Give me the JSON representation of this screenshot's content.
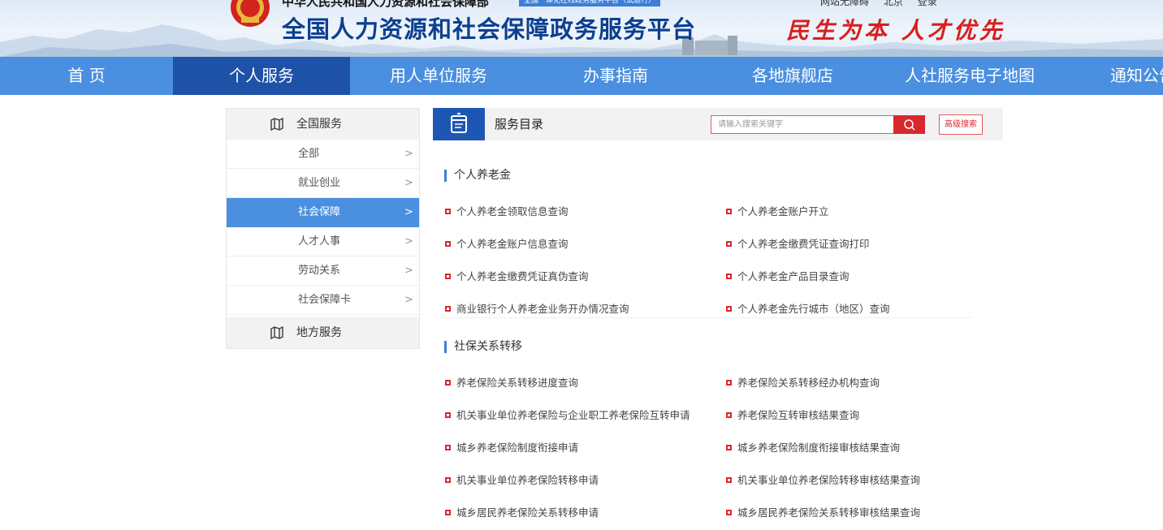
{
  "header": {
    "ministry": "中华人民共和国人力资源和社会保障部",
    "trial_badge": "全国一体化在线政务服务平台（试运行）",
    "platform_title": "全国人力资源和社会保障政务服务平台",
    "slogan": "民生为本 人才优先",
    "top_links": [
      "网站无障碍",
      "北京",
      "登录"
    ]
  },
  "nav": {
    "items": [
      "首 页",
      "个人服务",
      "用人单位服务",
      "办事指南",
      "各地旗舰店",
      "人社服务电子地图",
      "通知公告"
    ],
    "active": "个人服务"
  },
  "sidebar": {
    "national_label": "全国服务",
    "categories": [
      "全部",
      "就业创业",
      "社会保障",
      "人才人事",
      "劳动关系",
      "社会保障卡"
    ],
    "active_category": "社会保障",
    "local_label": "地方服务"
  },
  "catalog": {
    "title": "服务目录",
    "search_placeholder": "请输入搜索关键字",
    "advanced_search": "高级搜索"
  },
  "sections": [
    {
      "title": "个人养老金",
      "items": [
        "个人养老金领取信息查询",
        "个人养老金账户开立",
        "个人养老金账户信息查询",
        "个人养老金缴费凭证查询打印",
        "个人养老金缴费凭证真伪查询",
        "个人养老金产品目录查询",
        "商业银行个人养老金业务开办情况查询",
        "个人养老金先行城市（地区）查询"
      ]
    },
    {
      "title": "社保关系转移",
      "items": [
        "养老保险关系转移进度查询",
        "养老保险关系转移经办机构查询",
        "机关事业单位养老保险与企业职工养老保险互转申请",
        "养老保险互转审核结果查询",
        "城乡养老保险制度衔接申请",
        "城乡养老保险制度衔接审核结果查询",
        "机关事业单位养老保险转移申请",
        "机关事业单位养老保险转移审核结果查询",
        "城乡居民养老保险关系转移申请",
        "城乡居民养老保险关系转移审核结果查询"
      ]
    }
  ],
  "colors": {
    "nav_bg": "#4a8fe0",
    "nav_active": "#1e51a8",
    "accent_red": "#d9282d",
    "title_blue": "#0c3f8f"
  }
}
